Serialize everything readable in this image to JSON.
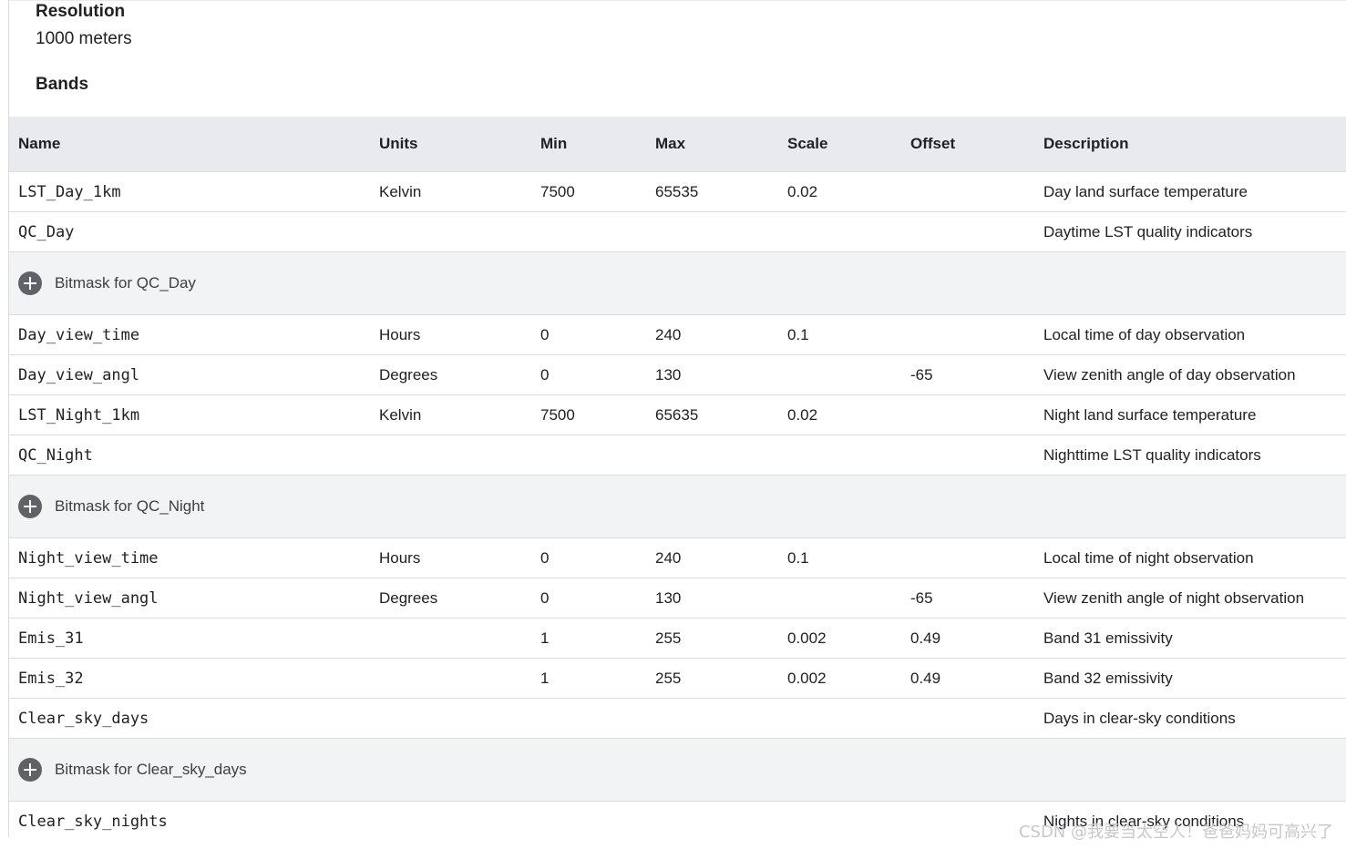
{
  "resolution": {
    "heading": "Resolution",
    "value": "1000 meters"
  },
  "bands": {
    "heading": "Bands",
    "columns": {
      "name": "Name",
      "units": "Units",
      "min": "Min",
      "max": "Max",
      "scale": "Scale",
      "offset": "Offset",
      "description": "Description"
    },
    "rows": [
      {
        "name": "LST_Day_1km",
        "units": "Kelvin",
        "min": "7500",
        "max": "65535",
        "scale": "0.02",
        "offset": "",
        "description": "Day land surface temperature"
      },
      {
        "name": "QC_Day",
        "units": "",
        "min": "",
        "max": "",
        "scale": "",
        "offset": "",
        "description": "Daytime LST quality indicators"
      },
      {
        "bitmask": "Bitmask for QC_Day"
      },
      {
        "name": "Day_view_time",
        "units": "Hours",
        "min": "0",
        "max": "240",
        "scale": "0.1",
        "offset": "",
        "description": "Local time of day observation"
      },
      {
        "name": "Day_view_angl",
        "units": "Degrees",
        "min": "0",
        "max": "130",
        "scale": "",
        "offset": "-65",
        "description": "View zenith angle of day observation"
      },
      {
        "name": "LST_Night_1km",
        "units": "Kelvin",
        "min": "7500",
        "max": "65635",
        "scale": "0.02",
        "offset": "",
        "description": "Night land surface temperature"
      },
      {
        "name": "QC_Night",
        "units": "",
        "min": "",
        "max": "",
        "scale": "",
        "offset": "",
        "description": "Nighttime LST quality indicators"
      },
      {
        "bitmask": "Bitmask for QC_Night"
      },
      {
        "name": "Night_view_time",
        "units": "Hours",
        "min": "0",
        "max": "240",
        "scale": "0.1",
        "offset": "",
        "description": "Local time of night observation"
      },
      {
        "name": "Night_view_angl",
        "units": "Degrees",
        "min": "0",
        "max": "130",
        "scale": "",
        "offset": "-65",
        "description": "View zenith angle of night observation"
      },
      {
        "name": "Emis_31",
        "units": "",
        "min": "1",
        "max": "255",
        "scale": "0.002",
        "offset": "0.49",
        "description": "Band 31 emissivity"
      },
      {
        "name": "Emis_32",
        "units": "",
        "min": "1",
        "max": "255",
        "scale": "0.002",
        "offset": "0.49",
        "description": "Band 32 emissivity"
      },
      {
        "name": "Clear_sky_days",
        "units": "",
        "min": "",
        "max": "",
        "scale": "",
        "offset": "",
        "description": "Days in clear-sky conditions"
      },
      {
        "bitmask": "Bitmask for Clear_sky_days"
      },
      {
        "name": "Clear_sky_nights",
        "units": "",
        "min": "",
        "max": "",
        "scale": "",
        "offset": "",
        "description": "Nights in clear-sky conditions"
      }
    ]
  },
  "watermark": "CSDN @我要当太空人！爸爸妈妈可高兴了",
  "colors": {
    "header_bg": "#e8eaed",
    "bitmask_bg": "#f1f3f4",
    "icon": "#5f6368",
    "text": "#202124",
    "border": "#dadce0"
  }
}
